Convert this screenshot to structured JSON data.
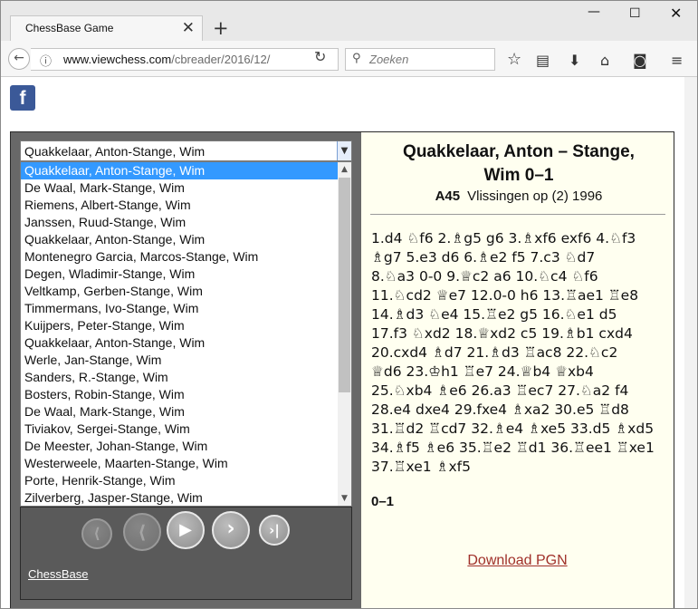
{
  "browser": {
    "tab_title": "ChessBase Game",
    "tab_close": "✕",
    "new_tab": "+",
    "url_host": "www.viewchess.com",
    "url_path": "/cbreader/2016/12/",
    "search_placeholder": "Zoeken",
    "icons": [
      "back-arrow-icon",
      "info-icon",
      "reload-icon",
      "search-icon",
      "bookmark-star-icon",
      "reading-list-icon",
      "download-icon",
      "home-icon",
      "pocket-icon",
      "menu-icon",
      "minimize-icon",
      "maximize-icon",
      "close-icon"
    ]
  },
  "page": {
    "facebook_label": "f",
    "game_select": {
      "selected": "Quakkelaar, Anton-Stange, Wim",
      "options": [
        "Quakkelaar, Anton-Stange, Wim",
        "De Waal, Mark-Stange, Wim",
        "Riemens, Albert-Stange, Wim",
        "Janssen, Ruud-Stange, Wim",
        "Quakkelaar, Anton-Stange, Wim",
        "Montenegro Garcia, Marcos-Stange, Wim",
        "Degen, Wladimir-Stange, Wim",
        "Veltkamp, Gerben-Stange, Wim",
        "Timmermans, Ivo-Stange, Wim",
        "Kuijpers, Peter-Stange, Wim",
        "Quakkelaar, Anton-Stange, Wim",
        "Werle, Jan-Stange, Wim",
        "Sanders, R.-Stange, Wim",
        "Bosters, Robin-Stange, Wim",
        "De Waal, Mark-Stange, Wim",
        "Tiviakov, Sergei-Stange, Wim",
        "De Meester, Johan-Stange, Wim",
        "Westerweele, Maarten-Stange, Wim",
        "Porte, Henrik-Stange, Wim",
        "Zilverberg, Jasper-Stange, Wim"
      ]
    },
    "controls": [
      "first-move-button",
      "previous-move-button",
      "play-button",
      "next-move-button",
      "last-move-button"
    ],
    "chessbase_link": "ChessBase",
    "game": {
      "title_line1": "Quakkelaar, Anton  –  Stange,",
      "title_line2": "Wim  0–1",
      "eco": "A45",
      "event": "Vlissingen op  (2)  1996",
      "moves": [
        "1.d4  ♘f6  2.♗g5  g6  3.♗xf6  exf6  4.♘f3",
        "♗g7  5.e3  d6  6.♗e2  f5  7.c3  ♘d7",
        "8.♘a3  0-0  9.♕c2  a6  10.♘c4  ♘f6",
        "11.♘cd2  ♕e7  12.0-0  h6  13.♖ae1  ♖e8",
        "14.♗d3  ♘e4  15.♖e2  g5  16.♘e1  d5",
        "17.f3  ♘xd2  18.♕xd2  c5  19.♗b1  cxd4",
        "20.cxd4  ♗d7  21.♗d3  ♖ac8  22.♘c2",
        "♕d6  23.♔h1  ♖e7  24.♕b4  ♕xb4",
        "25.♘xb4  ♗e6  26.a3  ♖ec7  27.♘a2  f4",
        "28.e4  dxe4  29.fxe4  ♗xa2  30.e5  ♖d8",
        "31.♖d2  ♖cd7  32.♗e4  ♗xe5  33.d5  ♗xd5",
        "34.♗f5  ♗e6  35.♖e2  ♖d1  36.♖ee1  ♖xe1",
        "37.♖xe1  ♗xf5"
      ],
      "result": "0–1",
      "download_label": "Download PGN"
    }
  }
}
